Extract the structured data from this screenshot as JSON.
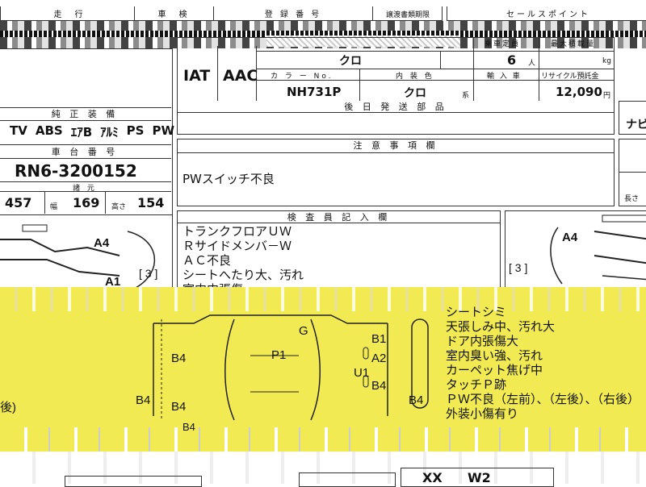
{
  "top_header": {
    "col1": "走　行",
    "col2": "車　検",
    "col3": "登 録 番 号",
    "col4": "譲渡書類期限",
    "col5": "セールスポイント"
  },
  "left_panel": {
    "equipment_header": "純 正 装 備",
    "equipment": [
      "TV",
      "ABS",
      "ｴｱB",
      "ｱﾙﾐ",
      "PS",
      "PW"
    ],
    "chassis_header": "車 台 番 号",
    "chassis_no": "RN6-3200152",
    "dims_header": "諸 元",
    "length": "457",
    "width_label": "幅",
    "width": "169",
    "height_label": "高さ",
    "height": "154",
    "diagram_labels": [
      "A4",
      "A1",
      "[ 3 ]"
    ]
  },
  "spec": {
    "transmission": "IAT",
    "aircon": "AAC",
    "color_name": "クロ",
    "capacity": "6",
    "capacity_unit": "人",
    "weight_unit": "kg",
    "color_no_label": "カ ラ ー No.",
    "interior_label": "内 装 色",
    "import_label": "輸 入 車",
    "recycle_label": "リサイクル預託金",
    "color_no": "NH731P",
    "interior": "クロ",
    "interior_suffix": "系",
    "recycle": "12,090",
    "recycle_unit": "円",
    "capacity_hdr": "乗車定員",
    "weight_hdr": "最大積載量",
    "later_parts_label": "後 日 発 送 部 品"
  },
  "notes": {
    "header": "注 意 事 項 欄",
    "text": "PWスイッチ不良"
  },
  "inspector": {
    "header": "検 査 員 記 入 欄",
    "lines": [
      "トランクフロアＵＷ",
      "Ｒサイドメンバ－Ｗ",
      "ＡＣ不良",
      "シートへたり大、汚れ",
      "室内内張傷"
    ]
  },
  "yellow_section": {
    "right_notes": [
      "シートシミ",
      "天張しみ中、汚れ大",
      "ドア内張傷大",
      "室内臭い強、汚れ",
      "カーペット焦げ中",
      "タッチＰ跡",
      "ＰＷ不良（左前）、（左後）、（右後）",
      "外装小傷有り"
    ],
    "diagram_marks": [
      "G",
      "P1",
      "B1",
      "A2",
      "U1",
      "B4",
      "B4",
      "B4",
      "B4",
      "B4",
      "B4"
    ],
    "left_fragment": "後)"
  },
  "right_panel": {
    "navi": "ナビ",
    "height_label": "長さ",
    "diagram_labels": [
      "A4",
      "[ 3 ]"
    ]
  },
  "bottom": {
    "grade1": "XX",
    "grade2": "W2"
  }
}
